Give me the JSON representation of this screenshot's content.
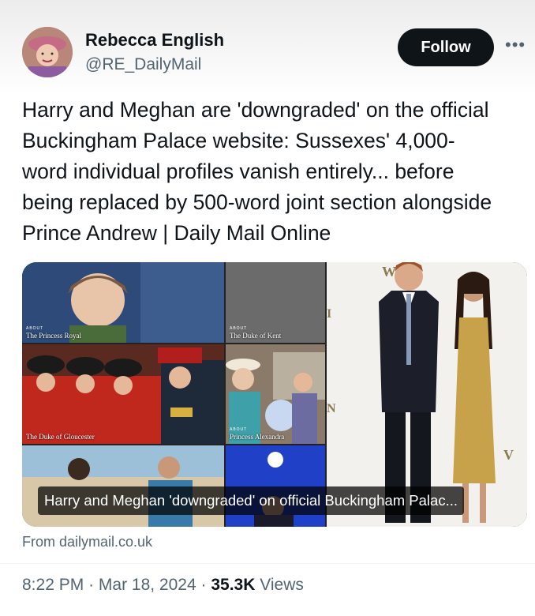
{
  "author": {
    "name": "Rebecca English",
    "handle": "@RE_DailyMail",
    "follow_label": "Follow",
    "more_icon": "more-icon"
  },
  "tweet": {
    "text_lines": [
      "Harry and Meghan are 'downgraded' on the official",
      "Buckingham Palace website: Sussexes' 4,000-",
      "word individual profiles vanish entirely... before",
      "being replaced by 500-word joint section alongside",
      "Prince Andrew | Daily Mail Online"
    ]
  },
  "card": {
    "tiles": [
      {
        "about": "ABOUT",
        "label": "The Princess Royal"
      },
      {
        "about": "ABOUT",
        "label": "The Duke of Kent"
      },
      {
        "about": "",
        "label": "The Duke of Gloucester"
      },
      {
        "about": "ABOUT",
        "label": "Princess Alexandra"
      }
    ],
    "caption": "Harry and Meghan 'downgraded' on official Buckingham Palac...",
    "source": "From dailymail.co.uk"
  },
  "meta": {
    "time": "8:22 PM",
    "sep1": "·",
    "date": "Mar 18, 2024",
    "sep2": "·",
    "views_count": "35.3K",
    "views_label": "Views"
  },
  "colors": {
    "text": "#0f1419",
    "secondary": "#536471",
    "follow_bg": "#0f1419",
    "gold_dress": "#c8a24a"
  }
}
